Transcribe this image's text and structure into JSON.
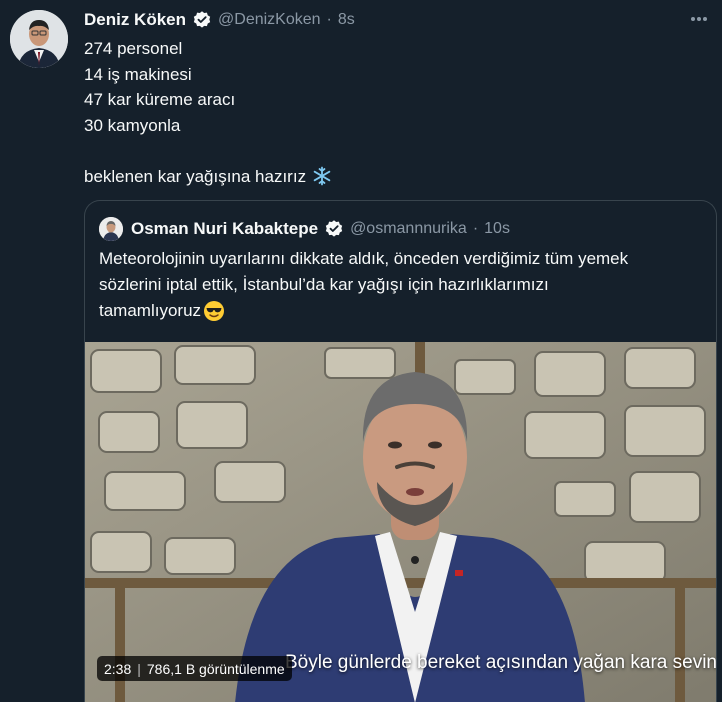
{
  "tweet": {
    "author_name": "Deniz Köken",
    "handle": "@DenizKoken",
    "separator": "·",
    "time": "8s",
    "lines": [
      "274 personel",
      "14 iş makinesi",
      "47 kar küreme aracı",
      "30 kamyonla"
    ],
    "final_line": "beklenen kar yağışına hazırız",
    "final_emoji": "snowflake-emoji"
  },
  "quoted": {
    "author_name": "Osman Nuri Kabaktepe",
    "handle": "@osmannnurika",
    "separator": "·",
    "time": "10s",
    "lines": [
      "Meteorolojinin uyarılarını dikkate aldık, önceden verdiğimiz tüm yemek",
      "sözlerini iptal ettik, İstanbul’da kar yağışı için hazırlıklarımızı",
      "tamamlıyoruz"
    ],
    "emoji": "sunglasses-emoji",
    "video": {
      "subtitle": "Böyle günlerde bereket açısından yağan kara sevinirken,",
      "duration": "2:38",
      "separator": "|",
      "views": "786,1 B görüntülenme"
    }
  },
  "colors": {
    "background": "#15202b",
    "text": "#f7f9f9",
    "secondary": "#8b98a5",
    "border": "#38444d",
    "verified": "#f7f9f9"
  }
}
